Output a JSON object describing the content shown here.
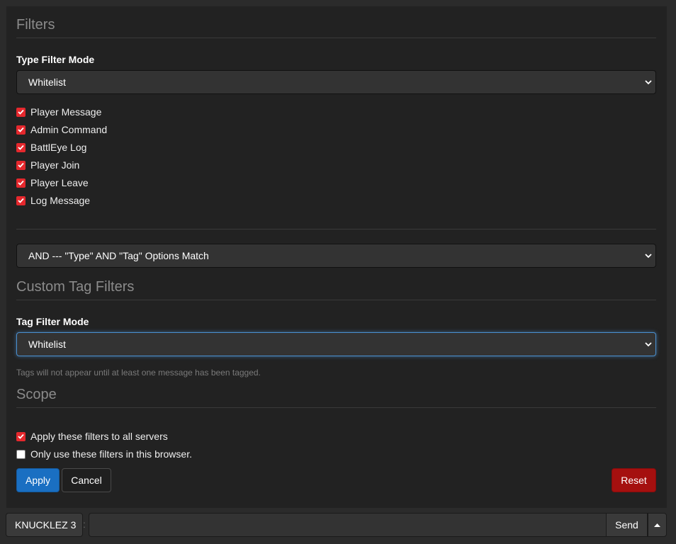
{
  "filters": {
    "title": "Filters",
    "type_filter_mode_label": "Type Filter Mode",
    "type_filter_mode_value": "Whitelist",
    "types": [
      {
        "label": "Player Message",
        "checked": true
      },
      {
        "label": "Admin Command",
        "checked": true
      },
      {
        "label": "BattlEye Log",
        "checked": true
      },
      {
        "label": "Player Join",
        "checked": true
      },
      {
        "label": "Player Leave",
        "checked": true
      },
      {
        "label": "Log Message",
        "checked": true
      }
    ],
    "match_mode_value": "AND --- \"Type\" AND \"Tag\" Options Match"
  },
  "custom_tags": {
    "title": "Custom Tag Filters",
    "tag_filter_mode_label": "Tag Filter Mode",
    "tag_filter_mode_value": "Whitelist",
    "help_text": "Tags will not appear until at least one message has been tagged."
  },
  "scope": {
    "title": "Scope",
    "options": [
      {
        "label": "Apply these filters to all servers",
        "checked": true
      },
      {
        "label": "Only use these filters in this browser.",
        "checked": false
      }
    ]
  },
  "actions": {
    "apply_label": "Apply",
    "cancel_label": "Cancel",
    "reset_label": "Reset"
  },
  "chat_bar": {
    "name_label": "KNUCKLEZ 3",
    "separator": ":",
    "input_value": "",
    "send_label": "Send"
  },
  "colors": {
    "checkbox_accent": "#e5282d",
    "apply_button": "#1a6fc2",
    "reset_button": "#a5100f",
    "focus_ring": "#4a90d0"
  },
  "icons": {
    "select_arrow": "chevron-down-icon",
    "checkbox_mark": "check-icon",
    "dropup": "caret-up-icon"
  }
}
